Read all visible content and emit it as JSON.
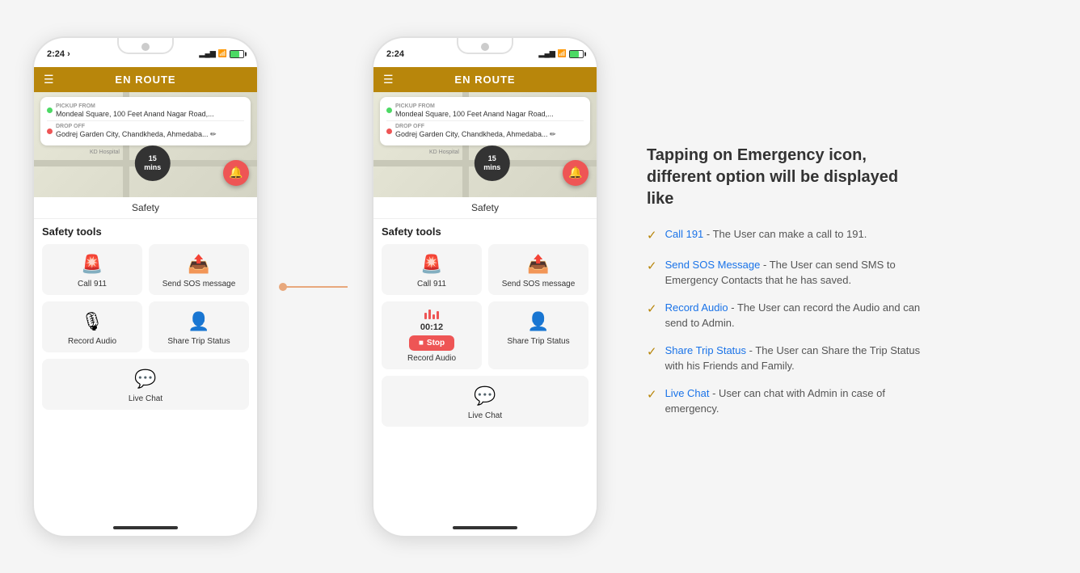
{
  "phones": [
    {
      "id": "phone1",
      "status_time": "2:24",
      "header_title": "EN ROUTE",
      "pickup_label": "PICKUP FROM",
      "pickup_address": "Mondeal Square, 100 Feet Anand Nagar Road,...",
      "dropoff_label": "DROP OFF",
      "dropoff_address": "Godrej Garden City, Chandkheda, Ahmedaba...",
      "map_minutes": "15",
      "map_mins_label": "mins",
      "safety_tab": "Safety",
      "safety_tools_title": "Safety tools",
      "tool1_label": "Call 911",
      "tool2_label": "Send SOS message",
      "tool3_label": "Record Audio",
      "tool4_label": "Share Trip Status",
      "tool5_label": "Live Chat",
      "recording_active": false
    },
    {
      "id": "phone2",
      "status_time": "2:24",
      "header_title": "EN ROUTE",
      "pickup_label": "PICKUP FROM",
      "pickup_address": "Mondeal Square, 100 Feet Anand Nagar Road,...",
      "dropoff_label": "DROP OFF",
      "dropoff_address": "Godrej Garden City, Chandkheda, Ahmedaba...",
      "map_minutes": "15",
      "map_mins_label": "mins",
      "safety_tab": "Safety",
      "safety_tools_title": "Safety tools",
      "tool1_label": "Call 911",
      "tool2_label": "Send SOS message",
      "tool3_label": "Record Audio",
      "tool4_label": "Share Trip Status",
      "tool5_label": "Live Chat",
      "recording_active": true,
      "record_timer": "00:12",
      "stop_label": "Stop"
    }
  ],
  "description": {
    "heading": "Tapping on Emergency icon, different option will be displayed like",
    "items": [
      {
        "text_prefix": "Call 191",
        "text_suffix": " - The User can make a call to 191.",
        "is_link": true
      },
      {
        "text_prefix": "Send SOS Message",
        "text_suffix": " - The User can send SMS to Emergency Contacts that he has saved.",
        "is_link": true
      },
      {
        "text_prefix": "Record Audio",
        "text_suffix": " - The User can record the Audio and can send to Admin.",
        "is_link": true
      },
      {
        "text_prefix": "Share Trip Status",
        "text_suffix": " - The User can Share the Trip Status with his Friends and Family.",
        "is_link": true
      },
      {
        "text_prefix": "Live Chat",
        "text_suffix": " - User can chat with Admin in case of emergency.",
        "is_link": true
      }
    ]
  }
}
